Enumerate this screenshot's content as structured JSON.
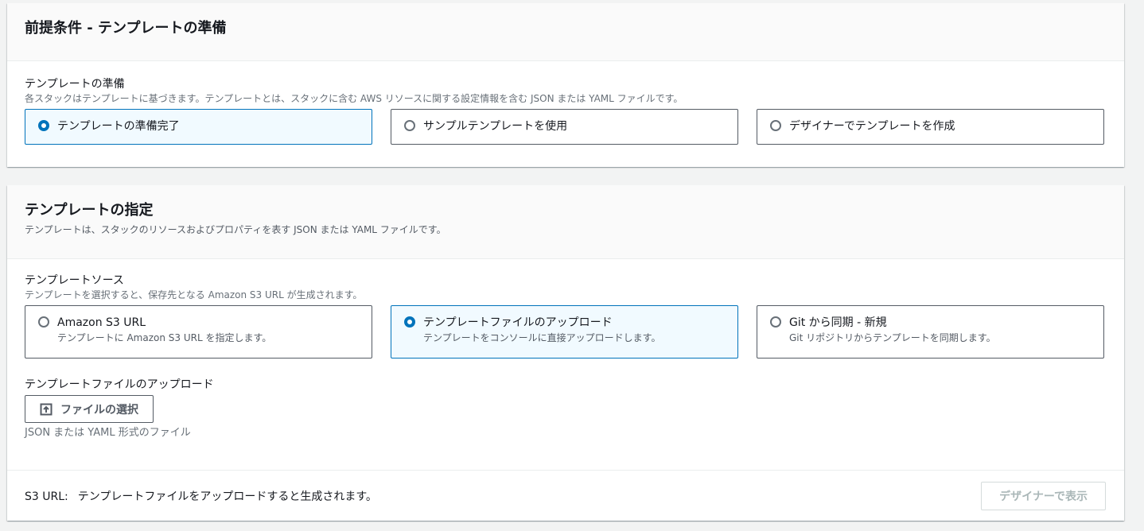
{
  "prereq": {
    "title": "前提条件 - テンプレートの準備",
    "field_label": "テンプレートの準備",
    "field_desc": "各スタックはテンプレートに基づきます。テンプレートとは、スタックに含む AWS リソースに関する設定情報を含む JSON または YAML ファイルです。",
    "options": [
      {
        "label": "テンプレートの準備完了",
        "selected": true
      },
      {
        "label": "サンプルテンプレートを使用",
        "selected": false
      },
      {
        "label": "デザイナーでテンプレートを作成",
        "selected": false
      }
    ]
  },
  "spec": {
    "title": "テンプレートの指定",
    "desc": "テンプレートは、スタックのリソースおよびプロパティを表す JSON または YAML ファイルです。",
    "source_label": "テンプレートソース",
    "source_desc": "テンプレートを選択すると、保存先となる Amazon S3 URL が生成されます。",
    "sources": [
      {
        "label": "Amazon S3 URL",
        "desc": "テンプレートに Amazon S3 URL を指定します。",
        "selected": false
      },
      {
        "label": "テンプレートファイルのアップロード",
        "desc": "テンプレートをコンソールに直接アップロードします。",
        "selected": true
      },
      {
        "label": "Git から同期 - 新規",
        "desc": "Git リポジトリからテンプレートを同期します。",
        "selected": false
      }
    ],
    "upload_label": "テンプレートファイルのアップロード",
    "upload_button": "ファイルの選択",
    "upload_hint": "JSON または YAML 形式のファイル",
    "s3_label": "S3 URL:",
    "s3_value": "テンプレートファイルをアップロードすると生成されます。",
    "designer_button": "デザイナーで表示"
  },
  "colors": {
    "accent": "#0073bb",
    "selected_bg": "#f1faff",
    "page_bg": "#f2f3f3"
  }
}
